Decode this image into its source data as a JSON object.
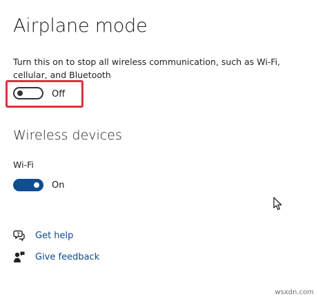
{
  "page": {
    "title": "Airplane mode",
    "description": "Turn this on to stop all wireless communication, such as Wi-Fi, cellular, and Bluetooth"
  },
  "airplane_toggle": {
    "state_label": "Off",
    "on": false
  },
  "wireless_devices": {
    "section_title": "Wireless devices",
    "wifi": {
      "label": "Wi-Fi",
      "state_label": "On",
      "on": true
    }
  },
  "links": {
    "get_help": "Get help",
    "give_feedback": "Give feedback"
  },
  "icons": {
    "help": "help-chat-icon",
    "feedback": "feedback-person-icon",
    "cursor": "mouse-pointer-icon"
  },
  "colors": {
    "toggle_on": "#0f4c92",
    "highlight": "#d9343c",
    "link": "#0b4a8b"
  },
  "watermark": "wsxdn.com"
}
